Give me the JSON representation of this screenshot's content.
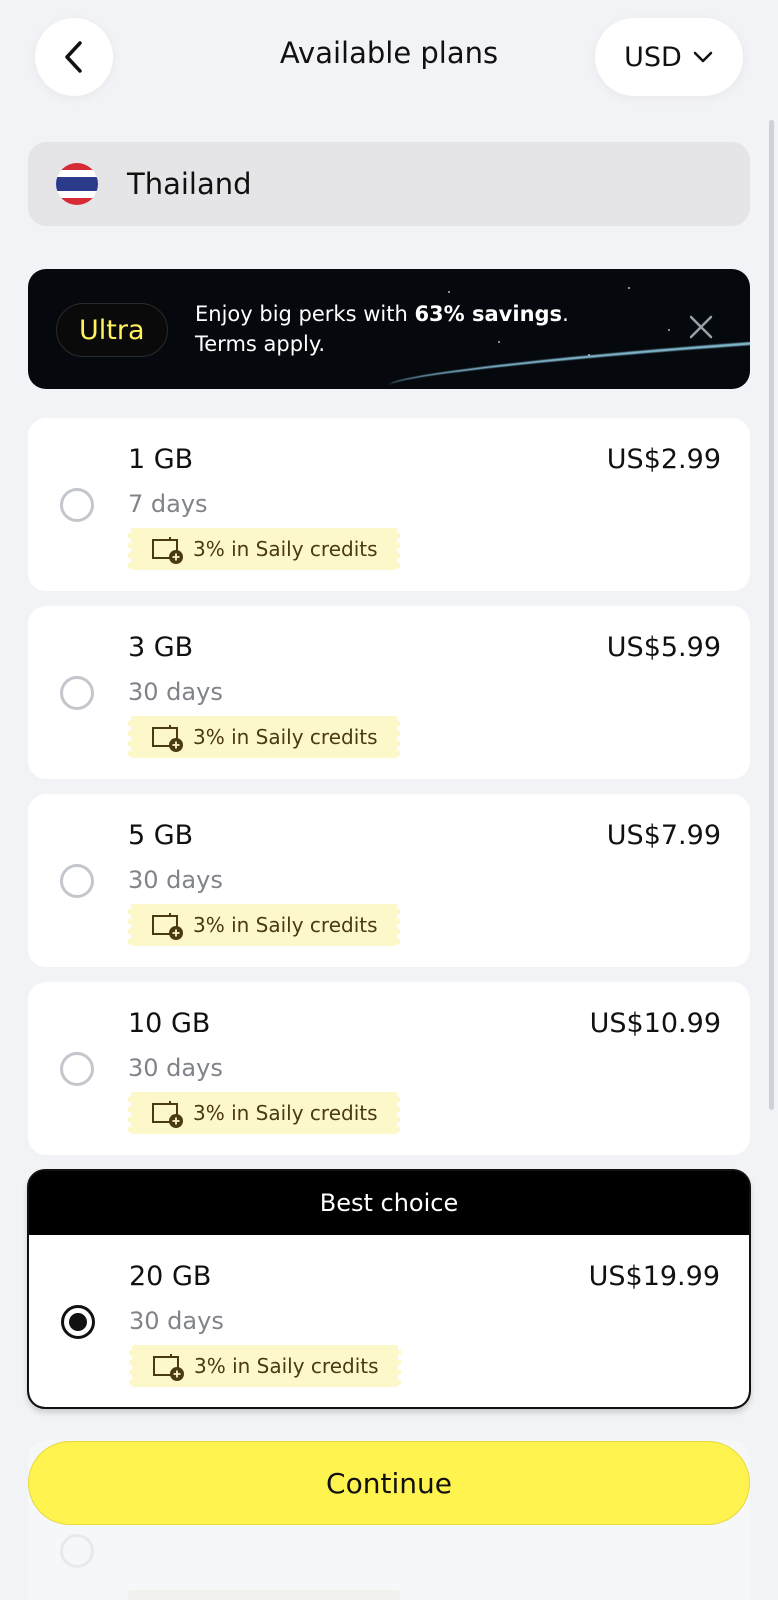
{
  "header": {
    "title": "Available plans",
    "currency": "USD"
  },
  "country": {
    "name": "Thailand"
  },
  "banner": {
    "badge": "Ultra",
    "text_prefix": "Enjoy big perks with ",
    "text_bold": "63% savings",
    "text_suffix": ".",
    "text_line2": "Terms apply."
  },
  "plans": [
    {
      "data": "1 GB",
      "price": "US$2.99",
      "duration": "7 days",
      "credits": "3% in Saily credits",
      "selected": false
    },
    {
      "data": "3 GB",
      "price": "US$5.99",
      "duration": "30 days",
      "credits": "3% in Saily credits",
      "selected": false
    },
    {
      "data": "5 GB",
      "price": "US$7.99",
      "duration": "30 days",
      "credits": "3% in Saily credits",
      "selected": false
    },
    {
      "data": "10 GB",
      "price": "US$10.99",
      "duration": "30 days",
      "credits": "3% in Saily credits",
      "selected": false
    }
  ],
  "best_choice": {
    "label": "Best choice",
    "plan": {
      "data": "20 GB",
      "price": "US$19.99",
      "duration": "30 days",
      "credits": "3% in Saily credits",
      "selected": true
    }
  },
  "continue_label": "Continue",
  "colors": {
    "accent": "#fff350",
    "badge_text": "#fff25a",
    "credits_bg": "#fdf8c9",
    "background": "#f2f3f6"
  }
}
